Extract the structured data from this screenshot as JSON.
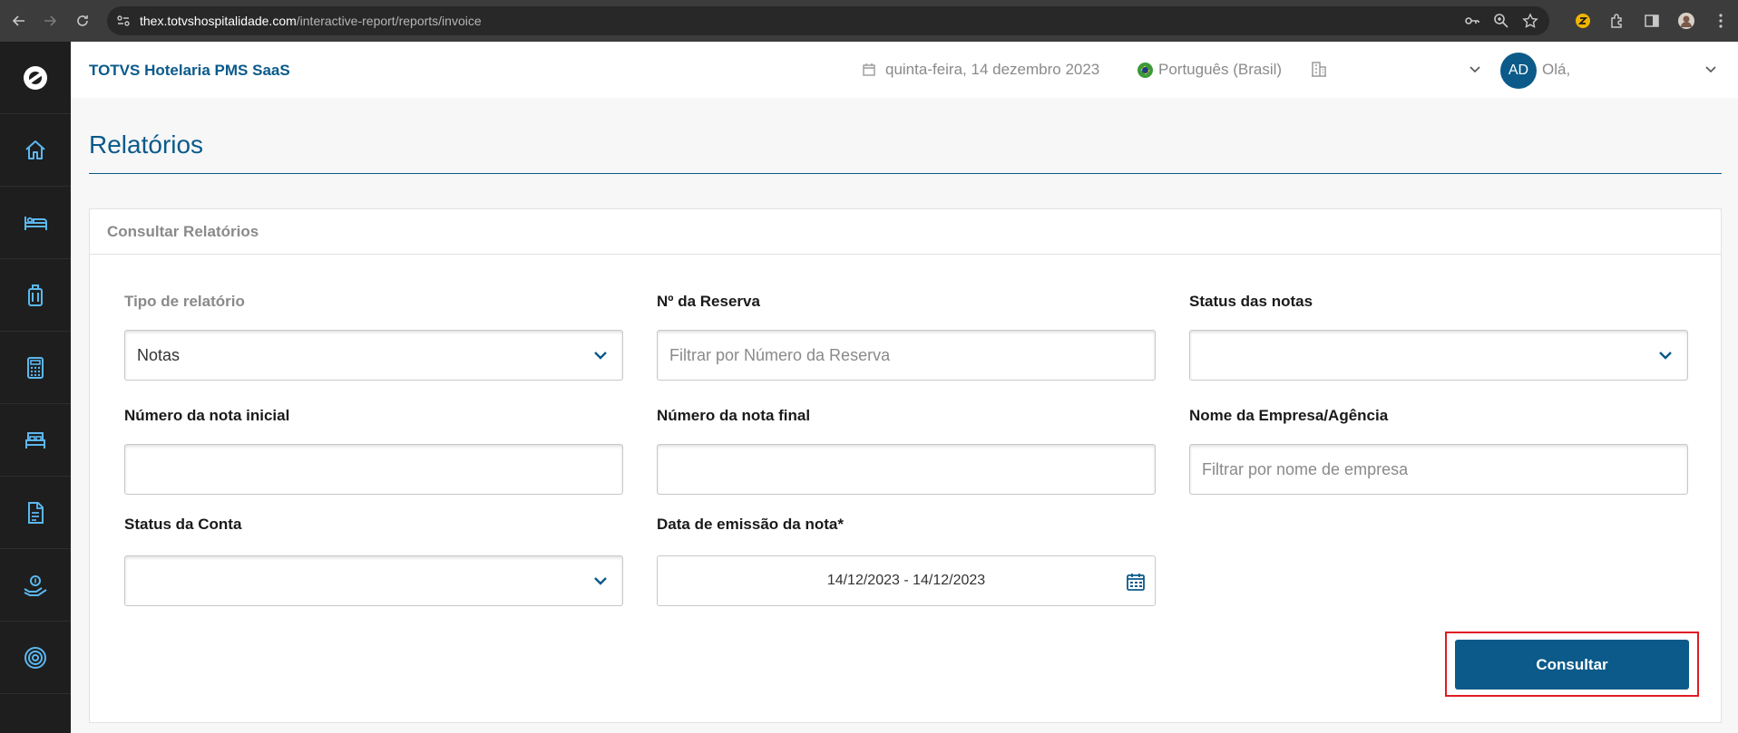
{
  "browser": {
    "url_host": "thex.totvshospitalidade.com",
    "url_path": "/interactive-report/reports/invoice"
  },
  "header": {
    "brand": "TOTVS Hotelaria PMS SaaS",
    "date": "quinta-feira, 14 dezembro 2023",
    "language": "Português (Brasil)",
    "avatar_initials": "AD",
    "greeting": "Olá,"
  },
  "sidebar": {
    "items": [
      "logo-icon",
      "home-icon",
      "bed-icon",
      "luggage-icon",
      "calculator-icon",
      "double-bed-icon",
      "document-icon",
      "money-hand-icon",
      "target-icon"
    ]
  },
  "page": {
    "title": "Relatórios"
  },
  "card": {
    "title": "Consultar Relatórios",
    "fields": {
      "tipo_label": "Tipo de relatório",
      "tipo_value": "Notas",
      "reserva_label": "Nº da Reserva",
      "reserva_placeholder": "Filtrar por Número da Reserva",
      "status_notas_label": "Status das notas",
      "status_notas_value": "",
      "nota_inicial_label": "Número da nota inicial",
      "nota_inicial_value": "",
      "nota_final_label": "Número da nota final",
      "nota_final_value": "",
      "empresa_label": "Nome da Empresa/Agência",
      "empresa_placeholder": "Filtrar por nome de empresa",
      "status_conta_label": "Status da Conta",
      "status_conta_value": "",
      "data_label": "Data de emissão da nota*",
      "data_value": "14/12/2023 - 14/12/2023"
    },
    "submit_label": "Consultar"
  },
  "colors": {
    "brand": "#0b5a8a",
    "sidebar_bg": "#1e1e1e",
    "sidebar_icon": "#5bb8f0",
    "highlight": "#e01b24"
  }
}
